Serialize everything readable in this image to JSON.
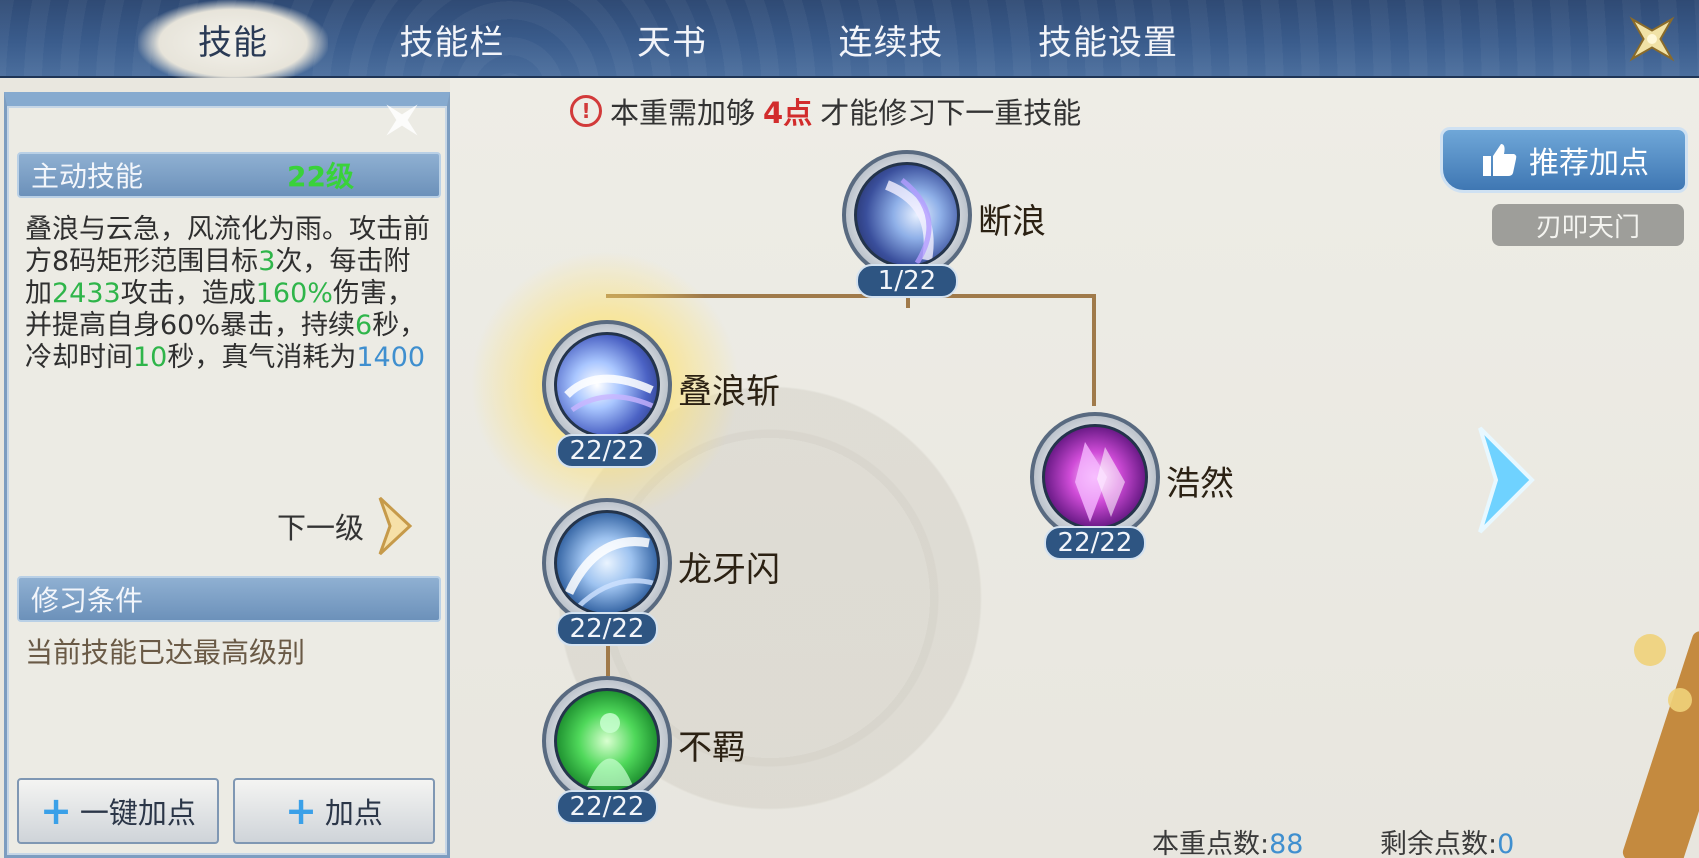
{
  "tabs": [
    {
      "label": "技能",
      "active": true
    },
    {
      "label": "技能栏",
      "active": false
    },
    {
      "label": "天书",
      "active": false
    },
    {
      "label": "连续技",
      "active": false
    },
    {
      "label": "技能设置",
      "active": false
    }
  ],
  "left_panel": {
    "section_title": "主动技能",
    "level": "22级",
    "description": {
      "part1": "叠浪与云急，风流化为雨。攻击前方8码矩形范围目标",
      "hits": "3",
      "part2": "次，每击附加",
      "bonus": "2433",
      "part3": "攻击，造成",
      "damage_pct": "160%",
      "part4": "伤害，并提高自身60%暴击，持续",
      "duration": "6",
      "part5": "秒，冷却时间",
      "cooldown": "10",
      "part6": "秒，真气消耗为",
      "cost": "1400"
    },
    "next_level_label": "下一级",
    "condition_title": "修习条件",
    "condition_text": "当前技能已达最高级别",
    "one_key_add_label": "一键加点",
    "add_label": "加点"
  },
  "notice": {
    "prefix": "本重需加够",
    "highlight": "4点",
    "suffix": "才能修习下一重技能"
  },
  "skills": [
    {
      "name": "断浪",
      "count": "1/22",
      "icon": "wave-slash-icon"
    },
    {
      "name": "叠浪斩",
      "count": "22/22",
      "icon": "wave-strike-icon"
    },
    {
      "name": "浩然",
      "count": "22/22",
      "icon": "crystal-icon"
    },
    {
      "name": "龙牙闪",
      "count": "22/22",
      "icon": "dragon-fang-icon"
    },
    {
      "name": "不羁",
      "count": "22/22",
      "icon": "meditation-icon"
    }
  ],
  "recommend_label": "推荐加点",
  "sect_label": "刃叩天门",
  "points": {
    "tier_label": "本重点数:",
    "tier_value": "88",
    "remaining_label": "剩余点数:",
    "remaining_value": "0"
  },
  "colors": {
    "topbar": "#3a5c8c",
    "highlight_green": "#2fb54a",
    "highlight_blue": "#3f8fcf",
    "warning_red": "#d22c2c"
  }
}
